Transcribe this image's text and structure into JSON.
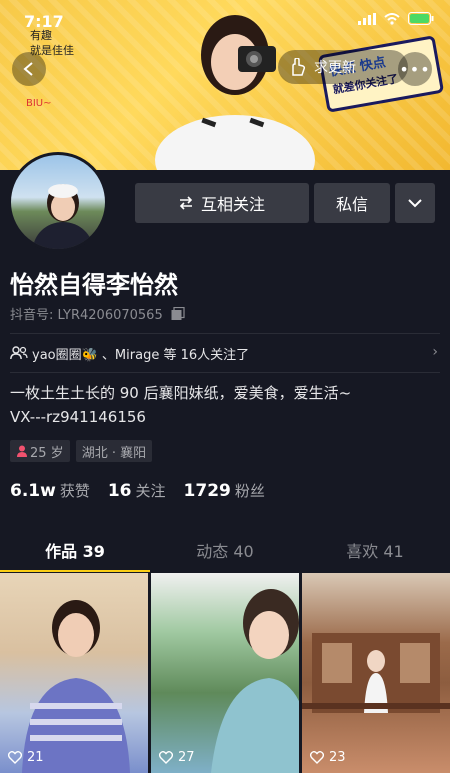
{
  "status_bar": {
    "time": "7:17"
  },
  "header": {
    "update_label": "求更新",
    "banner_sticker_line1": "快点 快点",
    "banner_sticker_line2": "就差你关注了",
    "banner_deco_line1": "有趣",
    "banner_deco_line2": "就是佳佳",
    "banner_biu": "BIU~"
  },
  "profile": {
    "name": "怡然自得李怡然",
    "douyin_id": "抖音号: LYR4206070565",
    "follow_button": "互相关注",
    "message_button": "私信",
    "followers_text": "yao圈圈🐝 、Mirage 等 16人关注了",
    "bio_line1": "一枚土生土长的 90 后襄阳妹纸，爱美食，爱生活~",
    "bio_line2": "VX---rz941146156",
    "age_tag": "25 岁",
    "location_tag": "湖北 · 襄阳",
    "stats": [
      {
        "num": "6.1w",
        "label": "获赞"
      },
      {
        "num": "16",
        "label": "关注"
      },
      {
        "num": "1729",
        "label": "粉丝"
      }
    ]
  },
  "tabs": [
    {
      "label": "作品 39"
    },
    {
      "label": "动态 40"
    },
    {
      "label": "喜欢 41"
    }
  ],
  "videos": [
    {
      "likes": "21"
    },
    {
      "likes": "27"
    },
    {
      "likes": "23"
    }
  ],
  "colors": {
    "background": "#161823",
    "accent": "#face15",
    "button": "#393b44"
  }
}
